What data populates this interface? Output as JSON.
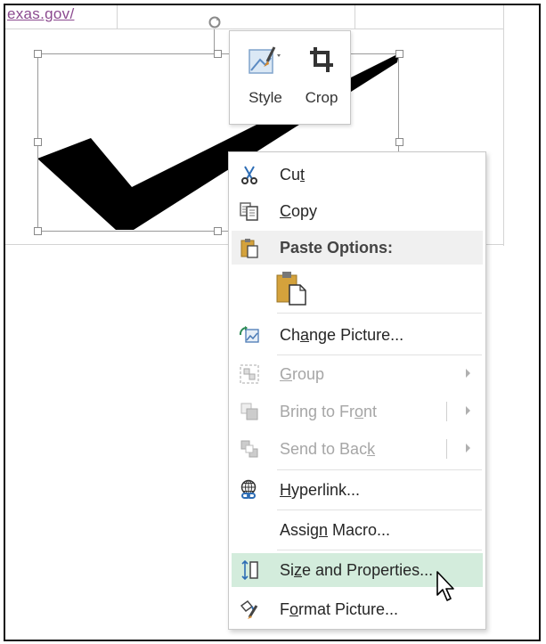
{
  "background": {
    "link_text": "exas.gov/"
  },
  "mini_toolbar": {
    "style_label": "Style",
    "crop_label": "Crop"
  },
  "context_menu": {
    "cut": {
      "pre": "Cu",
      "key": "t",
      "post": ""
    },
    "copy": {
      "pre": "",
      "key": "C",
      "post": "opy"
    },
    "paste_options_header": "Paste Options:",
    "change_picture": {
      "pre": "Ch",
      "key": "a",
      "post": "nge Picture..."
    },
    "group": {
      "pre": "",
      "key": "G",
      "post": "roup"
    },
    "bring_to_front": {
      "pre": "Bring to Fr",
      "key": "o",
      "post": "nt"
    },
    "send_to_back": {
      "pre": "Send to Bac",
      "key": "k",
      "post": ""
    },
    "hyperlink": {
      "pre": "",
      "key": "H",
      "post": "yperlink..."
    },
    "assign_macro": {
      "pre": "Assig",
      "key": "n",
      "post": " Macro..."
    },
    "size_and_properties": {
      "pre": "Si",
      "key": "z",
      "post": "e and Properties..."
    },
    "format_picture": {
      "pre": "F",
      "key": "o",
      "post": "rmat Picture..."
    }
  },
  "colors": {
    "highlight": "#d3ecdc",
    "link": "#8b4a8f",
    "disabled_text": "#a6a6a6"
  }
}
